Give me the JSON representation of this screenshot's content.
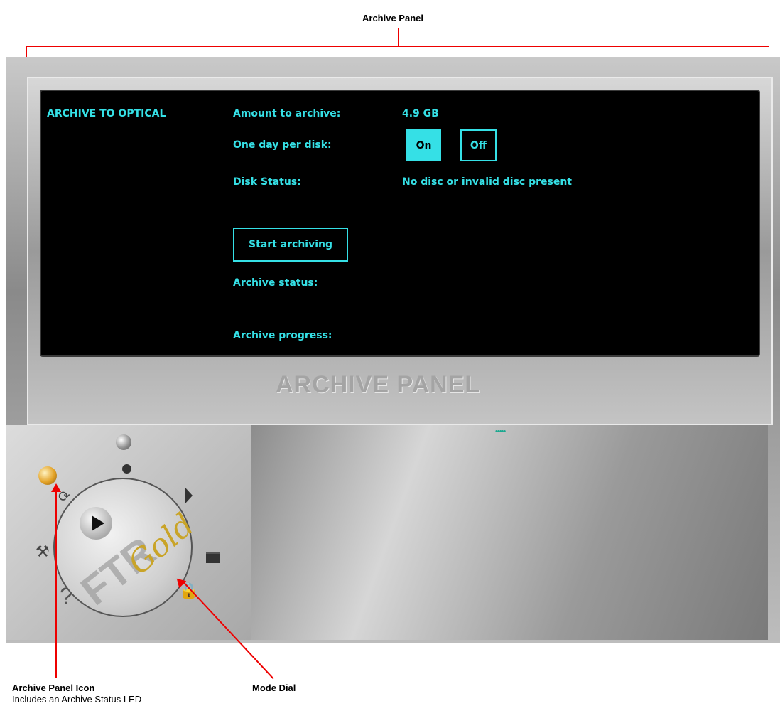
{
  "callouts": {
    "archive_panel": "Archive Panel",
    "archive_panel_icon": "Archive Panel Icon",
    "archive_panel_icon_sub": "Includes an Archive Status LED",
    "mode_dial": "Mode Dial"
  },
  "panel": {
    "section_title": "ARCHIVE TO OPTICAL",
    "amount_label": "Amount to archive:",
    "amount_value": "4.9 GB",
    "one_day_label": "One day per disk:",
    "on_label": "On",
    "off_label": "Off",
    "disk_status_label": "Disk Status:",
    "disk_status_value": "No disc or invalid disc present",
    "start_button": "Start archiving",
    "archive_status_label": "Archive status:",
    "archive_progress_label": "Archive progress:",
    "panel_name": "ARCHIVE PANEL"
  },
  "dial": {
    "brand": "FTR",
    "brand_script": "Gold",
    "help_symbol": "?",
    "tools_symbol": "⚒",
    "refresh_symbol": "⟳",
    "lock_symbol": "🔒"
  },
  "colors": {
    "screen_text": "#35e0e6",
    "led_amber": "#e3a226",
    "callout_line": "#e00000"
  }
}
